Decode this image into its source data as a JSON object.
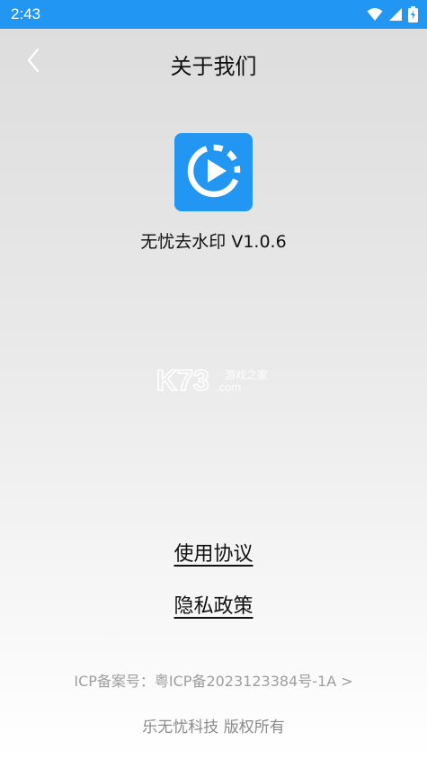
{
  "status_bar": {
    "time": "2:43",
    "background": "#2196f3",
    "icons": [
      "wifi-icon",
      "signal-icon",
      "battery-charging-icon"
    ]
  },
  "header": {
    "title": "关于我们",
    "back_icon": "chevron-left-icon"
  },
  "app": {
    "name_version": "无忧去水印 V1.0.6",
    "icon": "play-circle-icon",
    "icon_color": "#2196f3"
  },
  "watermark": {
    "brand": "K73",
    "sub": "游戏之家",
    "domain": ".com"
  },
  "links": {
    "agreement": "使用协议",
    "privacy": "隐私政策"
  },
  "footer": {
    "icp": "ICP备案号：粤ICP备2023123384号-1A >",
    "copyright": "乐无忧科技 版权所有"
  }
}
